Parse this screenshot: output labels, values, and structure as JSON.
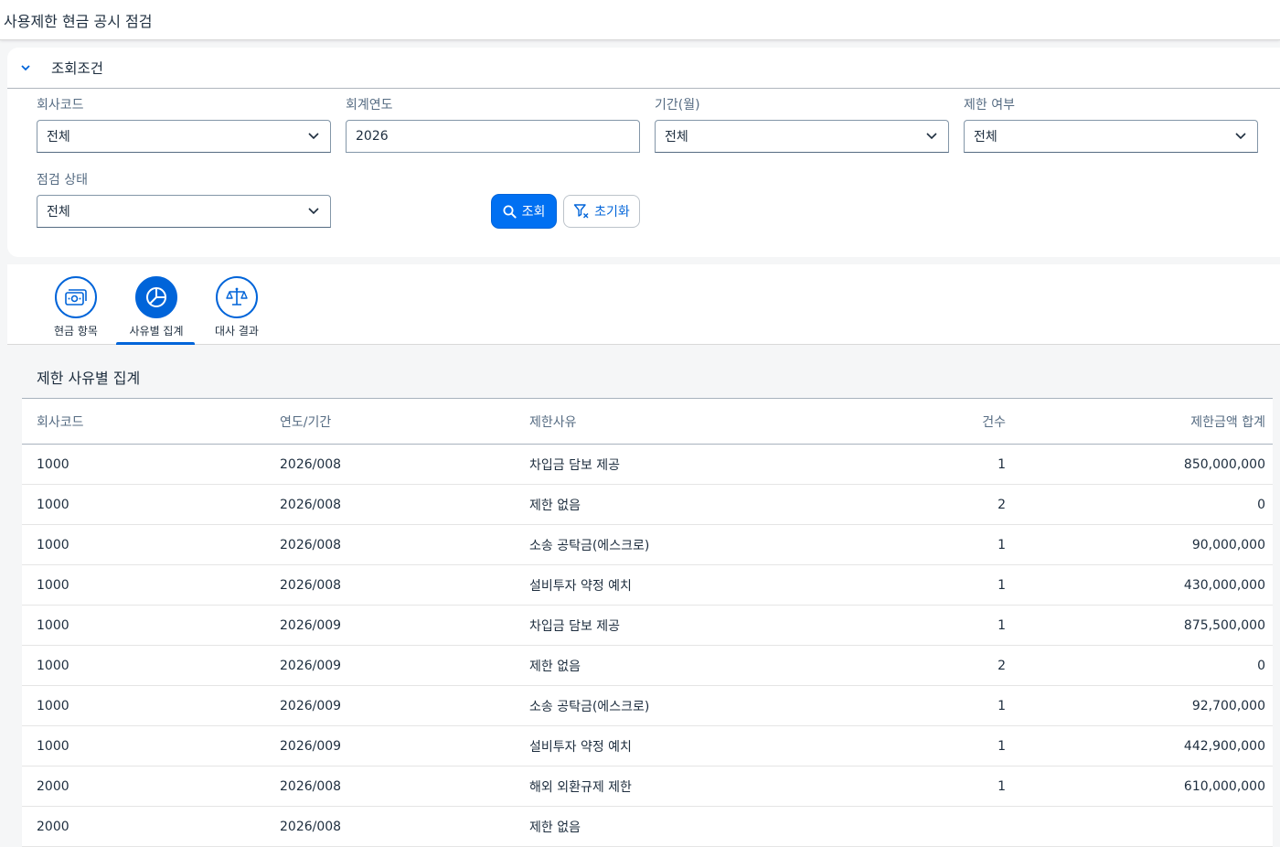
{
  "header": {
    "title": "사용제한 현금 공시 점검"
  },
  "filter": {
    "title": "조회조건",
    "fields": {
      "company_code": {
        "label": "회사코드",
        "value": "전체"
      },
      "fiscal_year": {
        "label": "회계연도",
        "value": "2026"
      },
      "period": {
        "label": "기간(월)",
        "value": "전체"
      },
      "restricted": {
        "label": "제한 여부",
        "value": "전체"
      },
      "check_status": {
        "label": "점검 상태",
        "value": "전체"
      }
    },
    "search_label": "조회",
    "reset_label": "초기화"
  },
  "tabs": [
    {
      "label": "현금 항목",
      "icon": "money-icon",
      "active": false
    },
    {
      "label": "사유별 집계",
      "icon": "pie-chart-icon",
      "active": true
    },
    {
      "label": "대사 결과",
      "icon": "balance-scale-icon",
      "active": false
    }
  ],
  "table": {
    "title": "제한 사유별 집계",
    "columns": [
      "회사코드",
      "연도/기간",
      "제한사유",
      "건수",
      "제한금액 합계"
    ],
    "rows": [
      [
        "1000",
        "2026/008",
        "차입금 담보 제공",
        "1",
        "850,000,000"
      ],
      [
        "1000",
        "2026/008",
        "제한 없음",
        "2",
        "0"
      ],
      [
        "1000",
        "2026/008",
        "소송 공탁금(에스크로)",
        "1",
        "90,000,000"
      ],
      [
        "1000",
        "2026/008",
        "설비투자 약정 예치",
        "1",
        "430,000,000"
      ],
      [
        "1000",
        "2026/009",
        "차입금 담보 제공",
        "1",
        "875,500,000"
      ],
      [
        "1000",
        "2026/009",
        "제한 없음",
        "2",
        "0"
      ],
      [
        "1000",
        "2026/009",
        "소송 공탁금(에스크로)",
        "1",
        "92,700,000"
      ],
      [
        "1000",
        "2026/009",
        "설비투자 약정 예치",
        "1",
        "442,900,000"
      ],
      [
        "2000",
        "2026/008",
        "해외 외환규제 제한",
        "1",
        "610,000,000"
      ],
      [
        "2000",
        "2026/008",
        "제한 없음",
        "",
        ""
      ]
    ]
  },
  "colors": {
    "brand": "#0064d9",
    "button": "#0070f2"
  }
}
